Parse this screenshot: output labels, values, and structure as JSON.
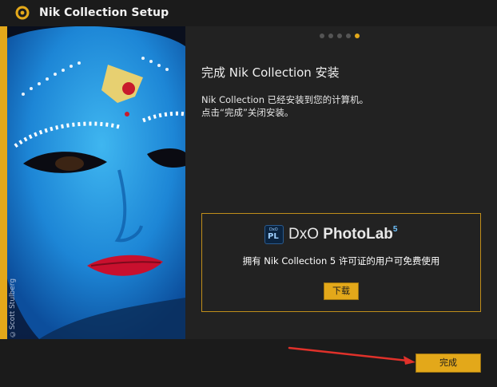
{
  "window": {
    "title": "Nik Collection Setup",
    "app_icon": "nik-aperture-icon"
  },
  "hero": {
    "photo_credit": "©Scott Stulberg"
  },
  "pager": {
    "total": 5,
    "active_index": 5
  },
  "main": {
    "heading": "完成 Nik Collection 安装",
    "desc_line1": "Nik Collection 已经安装到您的计算机。",
    "desc_line2": "点击“完成”关闭安装。"
  },
  "promo": {
    "logo_small": "DxO",
    "logo_pl": "PL",
    "brand_dxo": "DxO ",
    "brand_photolab": "PhotoLab",
    "brand_version": "5",
    "text": "拥有 Nik Collection 5 许可证的用户可免费使用",
    "download_label": "下载"
  },
  "footer": {
    "finish_label": "完成"
  },
  "colors": {
    "accent": "#e3a81a",
    "background": "#222222",
    "titlebar": "#1b1b1b",
    "annotation_arrow": "#e0312a"
  }
}
